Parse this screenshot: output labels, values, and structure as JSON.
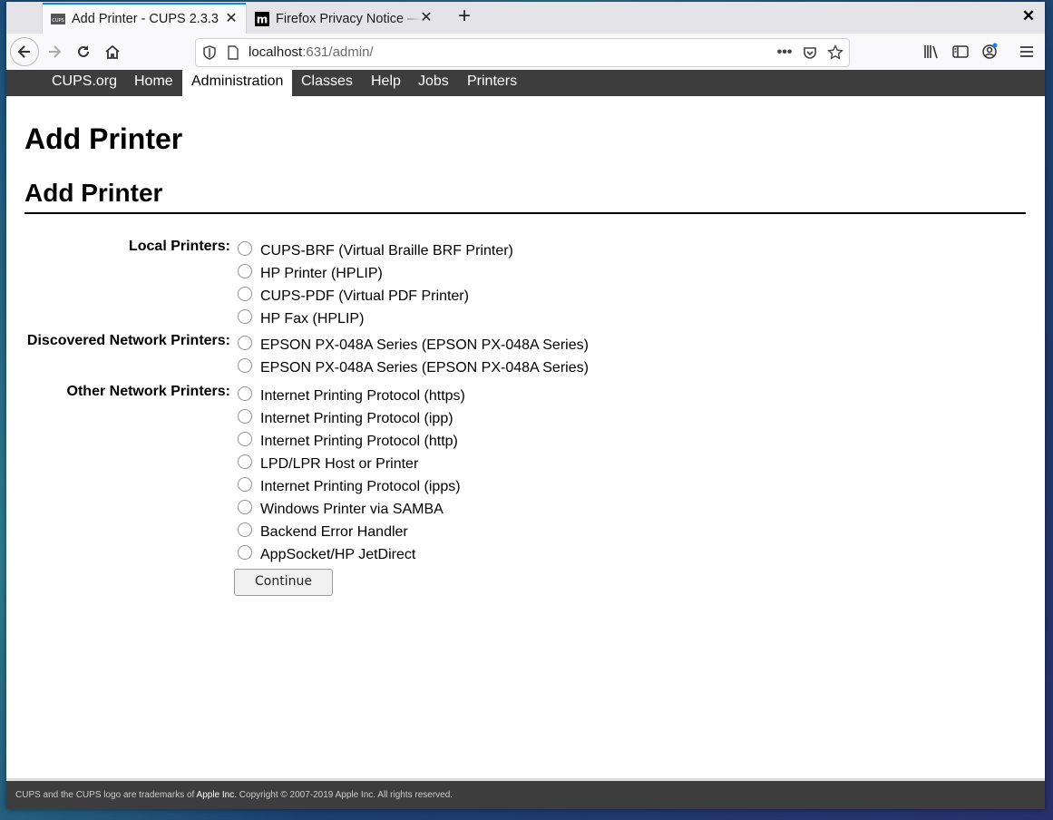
{
  "browser": {
    "tabs": [
      {
        "title": "Add Printer - CUPS 2.3.3",
        "favicon": "cups-icon",
        "active": true
      },
      {
        "title": "Firefox Privacy Notice — ",
        "favicon": "mozilla-icon",
        "active": false
      }
    ],
    "url_host": "localhost",
    "url_rest": ":631/admin/"
  },
  "cups_nav": {
    "items": [
      "CUPS.org",
      "Home",
      "Administration",
      "Classes",
      "Help",
      "Jobs",
      "Printers"
    ],
    "selected": "Administration"
  },
  "page": {
    "title": "Add Printer",
    "section_title": "Add Printer",
    "groups": [
      {
        "label": "Local Printers:",
        "options": [
          "CUPS-BRF (Virtual Braille BRF Printer)",
          "HP Printer (HPLIP)",
          "CUPS-PDF (Virtual PDF Printer)",
          "HP Fax (HPLIP)"
        ]
      },
      {
        "label": "Discovered Network Printers:",
        "options": [
          "EPSON PX-048A Series (EPSON PX-048A Series)",
          "EPSON PX-048A Series (EPSON PX-048A Series)"
        ]
      },
      {
        "label": "Other Network Printers:",
        "options": [
          "Internet Printing Protocol (https)",
          "Internet Printing Protocol (ipp)",
          "Internet Printing Protocol (http)",
          "LPD/LPR Host or Printer",
          "Internet Printing Protocol (ipps)",
          "Windows Printer via SAMBA",
          "Backend Error Handler",
          "AppSocket/HP JetDirect"
        ]
      }
    ],
    "continue_label": "Continue"
  },
  "footer": {
    "prefix": "CUPS and the CUPS logo are trademarks of ",
    "company": "Apple Inc.",
    "suffix": " Copyright © 2007-2019 Apple Inc. All rights reserved."
  }
}
